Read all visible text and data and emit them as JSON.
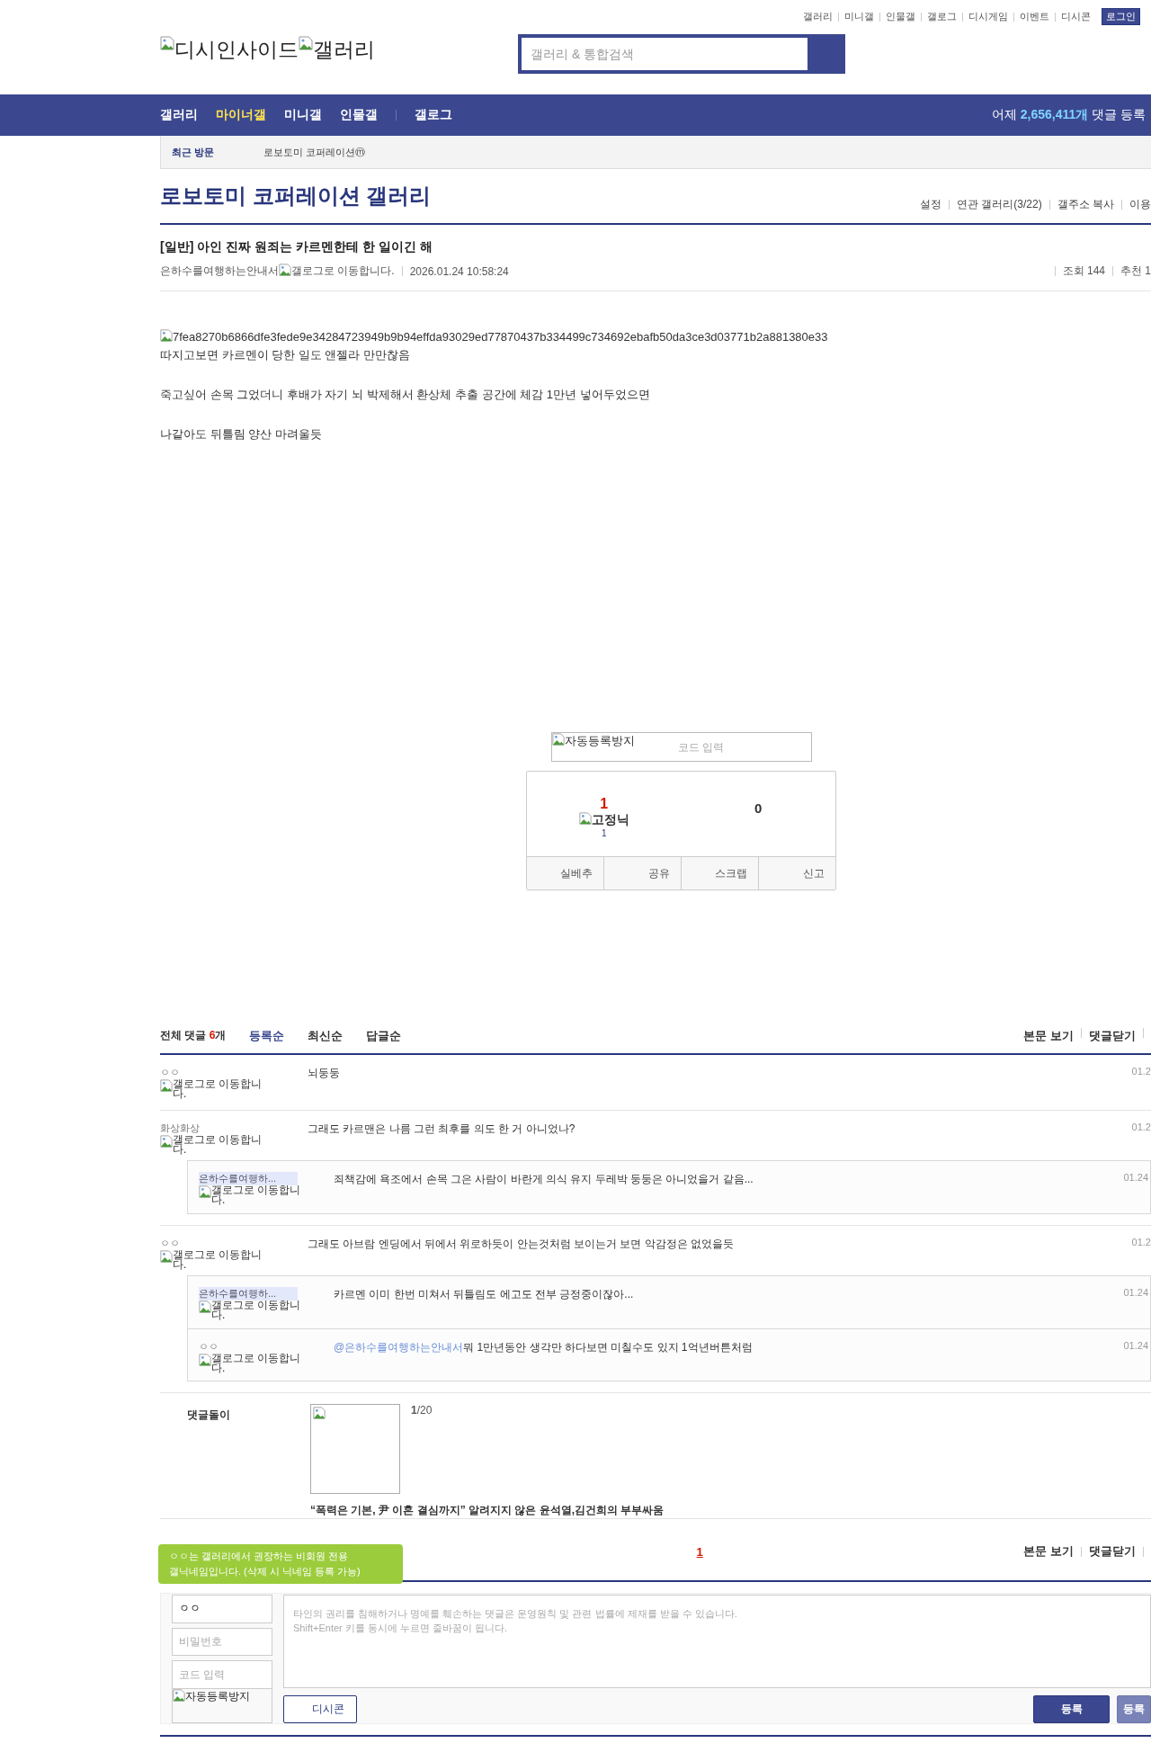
{
  "top_links": [
    "갤러리",
    "미니갤",
    "인물갤",
    "갤로그",
    "디시게임",
    "이벤트",
    "디시콘"
  ],
  "login_button": "로그인",
  "logo": {
    "alt_texts": [
      "디시인사이드",
      "갤러리"
    ]
  },
  "search": {
    "placeholder": "갤러리 & 통합검색"
  },
  "nav": {
    "items": [
      {
        "label": "갤러리",
        "selected": false
      },
      {
        "label": "마이너갤",
        "selected": true
      },
      {
        "label": "미니갤",
        "selected": false
      },
      {
        "label": "인물갤",
        "selected": false
      },
      {
        "label": "갤로그",
        "selected": false
      }
    ],
    "stat": {
      "prefix": "어제",
      "count": "2,656,411개",
      "suffix": "댓글 등록"
    }
  },
  "recent": {
    "label": "최근 방문",
    "items": [
      {
        "name": "로보토미 코퍼레이션",
        "badge": "ⓜ"
      }
    ]
  },
  "gallery": {
    "title": "로보토미 코퍼레이션 갤러리",
    "links": [
      "설정",
      "연관 갤러리(3/22)",
      "갤주소 복사",
      "이용"
    ]
  },
  "post": {
    "title": "[일반] 아인 진짜 원죄는 카르멘한테 한 일이긴 해",
    "author": "은하수를여행하는안내서",
    "author_icon_alt": "갤로그로 이동합니다.",
    "date": "2026.01.24 10:58:24",
    "views": "조회 144",
    "recommends": "추천 1",
    "image_alt": "7fea8270b6866dfe3fede9e34284723949b9b94effda93029ed77870437b334499c734692ebafb50da3ce3d03771b2a881380e33",
    "paragraphs": [
      "따지고보면 카르멘이 당한 일도 앤젤라 만만찮음",
      "죽고싶어 손목 그었더니 후배가 자기 뇌 박제해서 환상체 추출 공간에 체감 1만년 넣어두었으면",
      "나같아도 뒤틀림 양산 마려울듯"
    ]
  },
  "captcha": {
    "image_alt": "자동등록방지",
    "placeholder": "코드 입력"
  },
  "recommend": {
    "up_count": "1",
    "fixed_nick_alt": "고정닉",
    "fixed_count": "1",
    "down_count": "0",
    "buttons": [
      "실베추",
      "공유",
      "스크랩",
      "신고"
    ]
  },
  "comments": {
    "label": "전체 댓글",
    "count": "6",
    "unit": "개",
    "sorts": [
      {
        "label": "등록순",
        "selected": true
      },
      {
        "label": "최신순",
        "selected": false
      },
      {
        "label": "답글순",
        "selected": false
      }
    ],
    "links": [
      "본문 보기",
      "댓글닫기"
    ],
    "items": [
      {
        "author": "ㅇㅇ",
        "is_op": false,
        "icon_alt": "갤로그로 이동합니다.",
        "text": "뇌둥둥",
        "date": "01.2"
      },
      {
        "author": "화상화상",
        "is_op": false,
        "icon_alt": "갤로그로 이동합니다.",
        "text": "그래도 카르맨은 나름 그런 최후를 의도 한 거 아니었나?",
        "date": "01.2",
        "children": [
          {
            "author": "은하수를여행하...",
            "is_op": true,
            "icon_alt": "갤로그로 이동합니다.",
            "text": "죄책감에 욕조에서 손목 그은 사람이 바란게 의식 유지 두레박 둥둥은 아니었을거 같음...",
            "date": "01.24"
          }
        ]
      },
      {
        "author": "ㅇㅇ",
        "is_op": false,
        "icon_alt": "갤로그로 이동합니다.",
        "text": "그래도 아브람 엔딩에서 뒤에서 위로하듯이 안는것처럼 보이는거 보면 악감정은 없었을듯",
        "date": "01.2",
        "children": [
          {
            "author": "은하수를여행하...",
            "is_op": true,
            "icon_alt": "갤로그로 이동합니다.",
            "text": "카르멘 이미 한번 미쳐서 뒤틀림도 에고도 전부 긍정중이잖아...",
            "date": "01.24"
          },
          {
            "author": "ㅇㅇ",
            "is_op": false,
            "icon_alt": "갤로그로 이동합니다.",
            "mention": "@은하수를여행하는안내서",
            "text": "뭐 1만년동안 생각만 하다보면 미칠수도 있지 1억년버튼처럼",
            "date": "01.24"
          }
        ]
      }
    ]
  },
  "comment_bot": {
    "label": "댓글돌이",
    "counter": "**1**/20",
    "headline": "“폭력은 기본, 尹 이혼 결심까지” 알려지지 않은 윤석열,김건희의 부부싸움"
  },
  "bottom": {
    "pages": [
      {
        "label": "1",
        "selected": true
      }
    ],
    "links": [
      "본문 보기",
      "댓글닫기"
    ],
    "tooltip": [
      "ㅇㅇ는 갤러리에서 권장하는 비회원 전용",
      "갤닉네임입니다. (삭제 시 닉네임 등록 가능)"
    ]
  },
  "form": {
    "nickname": "ㅇㅇ",
    "password_placeholder": "비밀번호",
    "code_placeholder": "코드 입력",
    "captcha_alt": "자동등록방지",
    "comment_placeholder": "타인의 권리를 침해하거나 명예를 훼손하는 댓글은 운영원칙 및 관련 법률에 제재를 받을 수 있습니다.\nShift+Enter 키를 동시에 누르면 줄바꿈이 됩니다.",
    "dccon_button": "디시콘",
    "submit_buttons": [
      {
        "label": "등록",
        "kind": "primary"
      },
      {
        "label": "등록",
        "kind": "secondary"
      }
    ]
  }
}
